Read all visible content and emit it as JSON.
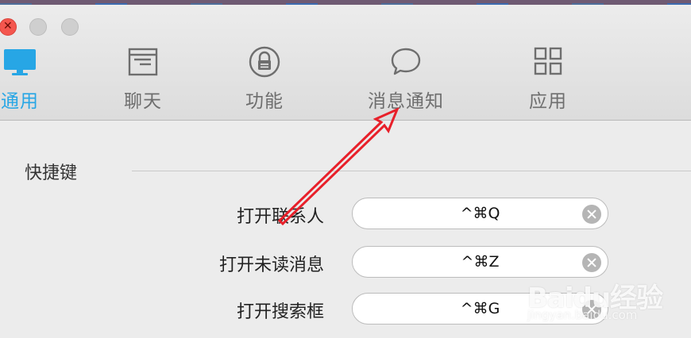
{
  "window": {
    "close_button": "close",
    "minimize_button": "minimize",
    "zoom_button": "zoom"
  },
  "toolbar": {
    "tabs": [
      {
        "label": "通用",
        "icon": "monitor-icon",
        "active": true
      },
      {
        "label": "聊天",
        "icon": "chat-window-icon",
        "active": false
      },
      {
        "label": "功能",
        "icon": "lock-icon",
        "active": false
      },
      {
        "label": "消息通知",
        "icon": "speech-bubble-icon",
        "active": false
      },
      {
        "label": "应用",
        "icon": "app-grid-icon",
        "active": false
      }
    ]
  },
  "colors": {
    "accent": "#27a6e5",
    "annotation_arrow": "#e8202a"
  },
  "shortcuts": {
    "section_title": "快捷键",
    "rows": [
      {
        "label": "打开联系人",
        "value": "^⌘Q"
      },
      {
        "label": "打开未读消息",
        "value": "^⌘Z"
      },
      {
        "label": "打开搜索框",
        "value": "^⌘G"
      }
    ]
  },
  "watermark": {
    "brand": "Baidu经验",
    "sub": "jingyan.baidu.com"
  }
}
